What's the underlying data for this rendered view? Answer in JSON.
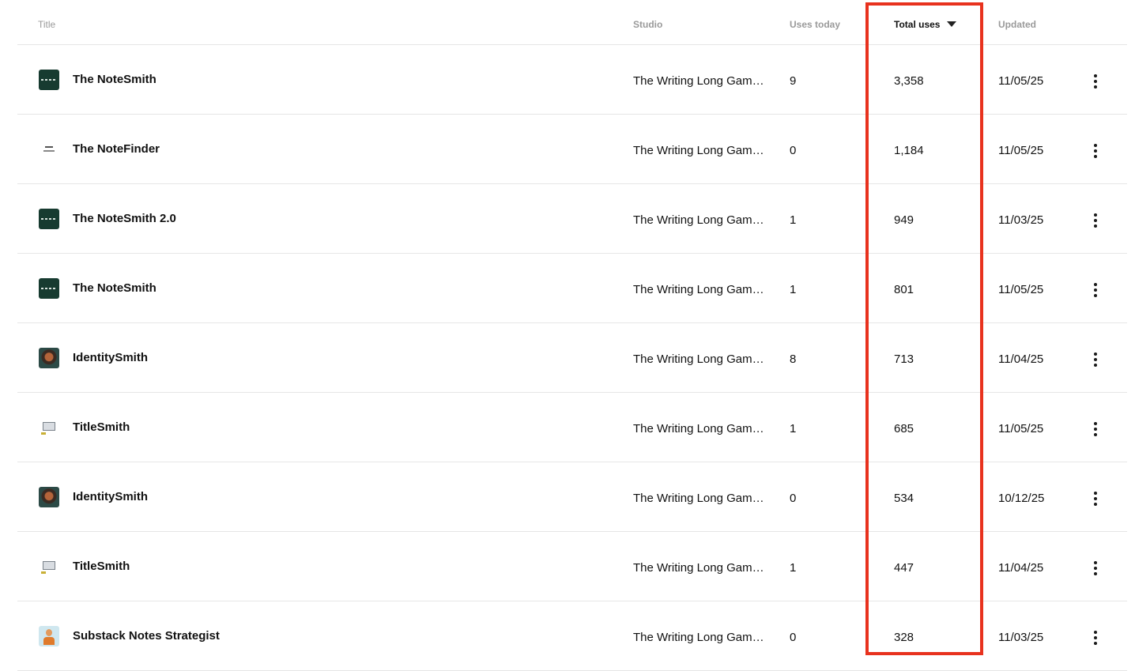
{
  "columns": {
    "title": "Title",
    "studio": "Studio",
    "uses_today": "Uses today",
    "total_uses": "Total uses",
    "updated": "Updated"
  },
  "sort": {
    "column": "Total uses",
    "direction": "descending"
  },
  "highlight_color": "#e8321e",
  "rows": [
    {
      "icon": "notesmith-logo",
      "title": "The NoteSmith",
      "studio": "The Writing Long Game Studio",
      "uses_today": "9",
      "total_uses": "3,358",
      "updated": "11/05/25"
    },
    {
      "icon": "notefinder-logo",
      "title": "The NoteFinder",
      "studio": "The Writing Long Game Studio",
      "uses_today": "0",
      "total_uses": "1,184",
      "updated": "11/05/25"
    },
    {
      "icon": "notesmith-logo",
      "title": "The NoteSmith 2.0",
      "studio": "The Writing Long Game Studio",
      "uses_today": "1",
      "total_uses": "949",
      "updated": "11/03/25"
    },
    {
      "icon": "notesmith-logo",
      "title": "The NoteSmith",
      "studio": "The Writing Long Game Studio",
      "uses_today": "1",
      "total_uses": "801",
      "updated": "11/05/25"
    },
    {
      "icon": "identitysmith-portrait",
      "title": "IdentitySmith",
      "studio": "The Writing Long Game Studio",
      "uses_today": "8",
      "total_uses": "713",
      "updated": "11/04/25"
    },
    {
      "icon": "titlesmith-screen",
      "title": "TitleSmith",
      "studio": "The Writing Long Game Studio",
      "uses_today": "1",
      "total_uses": "685",
      "updated": "11/05/25"
    },
    {
      "icon": "identitysmith-portrait",
      "title": "IdentitySmith",
      "studio": "The Writing Long Game Studio",
      "uses_today": "0",
      "total_uses": "534",
      "updated": "10/12/25"
    },
    {
      "icon": "titlesmith-screen",
      "title": "TitleSmith",
      "studio": "The Writing Long Game Studio",
      "uses_today": "1",
      "total_uses": "447",
      "updated": "11/04/25"
    },
    {
      "icon": "strategist-avatar",
      "title": "Substack Notes Strategist",
      "studio": "The Writing Long Game Studio",
      "uses_today": "0",
      "total_uses": "328",
      "updated": "11/03/25"
    }
  ]
}
